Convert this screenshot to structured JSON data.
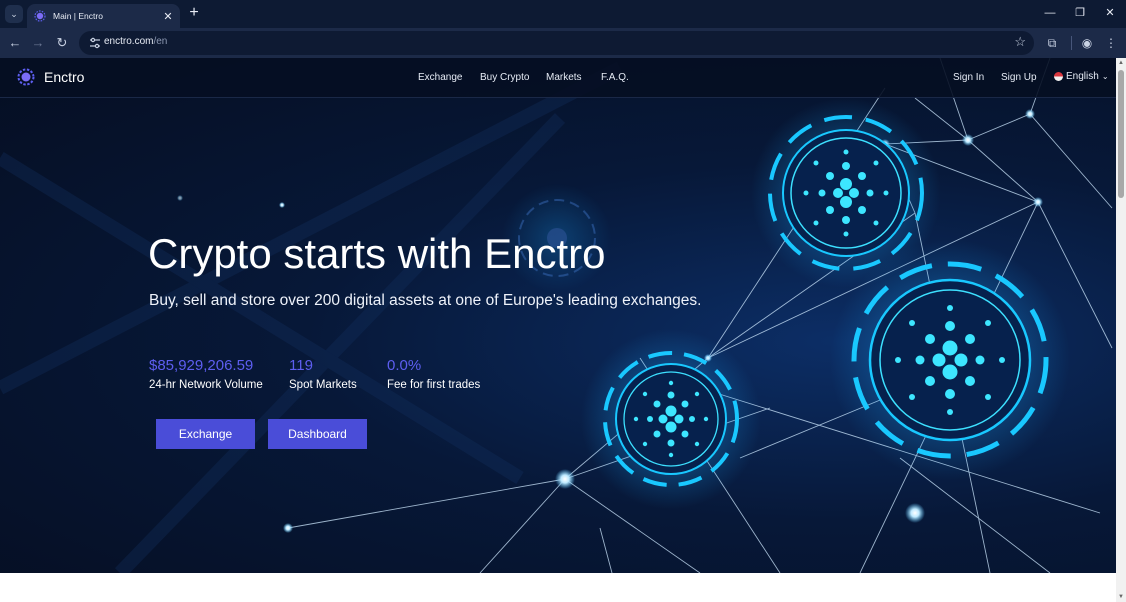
{
  "browser": {
    "tab_title": "Main | Enctro",
    "url_host": "enctro.com",
    "url_path": "/en"
  },
  "site": {
    "brand": "Enctro",
    "nav": [
      "Exchange",
      "Buy Crypto",
      "Markets",
      "F.A.Q."
    ],
    "sign_in": "Sign In",
    "sign_up": "Sign Up",
    "language": "English"
  },
  "hero": {
    "headline": "Crypto starts with Enctro",
    "subheadline": "Buy, sell and store over 200 digital assets at one of Europe's leading exchanges.",
    "stats": [
      {
        "value": "$85,929,206.59",
        "label": "24-hr Network Volume"
      },
      {
        "value": "119",
        "label": "Spot Markets"
      },
      {
        "value": "0.0%",
        "label": "Fee for first trades"
      }
    ],
    "buttons": [
      "Exchange",
      "Dashboard"
    ]
  },
  "colors": {
    "accent": "#4a4dd8",
    "stat_value": "#5d5ef0",
    "hero_bg": "#071838",
    "glow": "#22d3ff"
  }
}
